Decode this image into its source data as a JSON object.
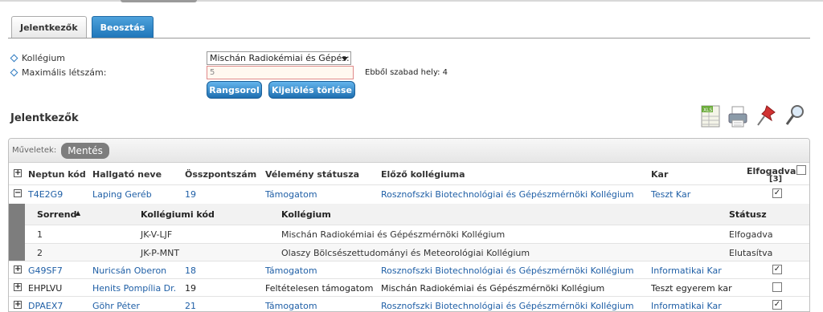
{
  "tabs": [
    {
      "label": "Jelentkezők",
      "active": false
    },
    {
      "label": "Beosztás",
      "active": true
    }
  ],
  "form": {
    "kollegium_label": "Kollégium",
    "kollegium_value": "Mischán Radiokémiai és Gépés:",
    "max_label": "Maximális létszám:",
    "max_value": "5",
    "free_text": "Ebből szabad hely: 4"
  },
  "buttons": {
    "rank": "Rangsorol",
    "clear": "Kijelölés törlése"
  },
  "section": {
    "title": "Jelentkezők"
  },
  "toolbar_icons": [
    "xls-export-icon",
    "print-icon",
    "pin-icon",
    "search-icon"
  ],
  "ops": {
    "label": "Műveletek:",
    "save": "Mentés"
  },
  "columns": {
    "neptun": "Neptun kód",
    "name": "Hallgató neve",
    "score": "Összpontszám",
    "opinion": "Vélemény státusza",
    "prev": "Előző kollégiuma",
    "faculty": "Kar",
    "accepted": "Elfogadva",
    "accepted_count": "[3]"
  },
  "rows": [
    {
      "expander": "−",
      "neptun": "T4E2G9",
      "name": "Laping Geréb",
      "score": "19",
      "opinion": "Támogatom",
      "prev": "Rosznofszki Biotechnológiai és Gépészmérnöki Kollégium",
      "faculty": "Teszt Kar",
      "checked": "✓"
    },
    {
      "expander": "+",
      "neptun": "G49SF7",
      "name": "Nuricsán Oberon",
      "score": "18",
      "opinion": "Támogatom",
      "prev": "Rosznofszki Biotechnológiai és Gépészmérnöki Kollégium",
      "faculty": "Informatikai Kar",
      "checked": "✓"
    },
    {
      "expander": "+",
      "neptun": "EHPLVU",
      "name": "Henits Pompília Dr.",
      "score": "19",
      "opinion": "Feltételesen támogatom",
      "prev": "Mischán Radiokémiai és Gépészmérnöki Kollégium",
      "faculty": "Teszt egyerem kar",
      "checked": ""
    },
    {
      "expander": "+",
      "neptun": "DPAEX7",
      "name": "Göhr Péter",
      "score": "21",
      "opinion": "Támogatom",
      "prev": "Rosznofszki Biotechnológiai és Gépészmérnöki Kollégium",
      "faculty": "Informatikai Kar",
      "checked": "✓"
    }
  ],
  "sub": {
    "headers": {
      "order": "Sorrend",
      "sort_icon": "▲",
      "code": "Kollégiumi kód",
      "kollegium": "Kollégium",
      "status": "Státusz"
    },
    "rows": [
      {
        "order": "1",
        "code": "JK-V-LJF",
        "kollegium": "Mischán Radiokémiai és Gépészmérnöki Kollégium",
        "status": "Elfogadva"
      },
      {
        "order": "2",
        "code": "JK-P-MNT",
        "kollegium": "Olaszy Bölcsészettudományi és Meteorológiai Kollégium",
        "status": "Elutasítva"
      }
    ]
  }
}
